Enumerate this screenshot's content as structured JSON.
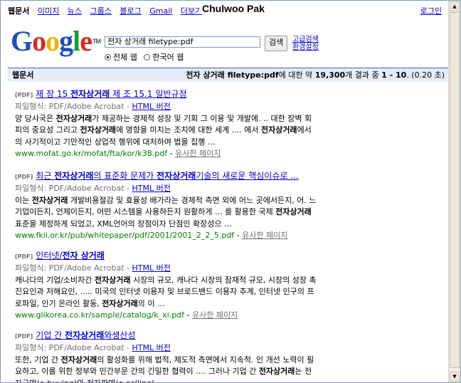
{
  "overlay_title": "Chulwoo Pak",
  "nav": {
    "items": [
      "웹문서",
      "이미지",
      "뉴스",
      "그룹스",
      "블로그",
      "Gmail",
      "더보기"
    ],
    "login": "로그인"
  },
  "logo": {
    "letters": [
      "G",
      "o",
      "o",
      "g",
      "l",
      "e"
    ],
    "colors": [
      "#1a4fc4",
      "#d62b22",
      "#f0b400",
      "#1a4fc4",
      "#189b3c",
      "#d62b22"
    ],
    "tm": "TM"
  },
  "search": {
    "query": "전자 상거래 filetype:pdf",
    "button": "검색",
    "advanced": "고급검색",
    "prefs": "환경설정"
  },
  "radios": [
    {
      "label": "전체 웹",
      "selected": true
    },
    {
      "label": "한국어 웹",
      "selected": false
    }
  ],
  "resultbar": {
    "left": "웹문서",
    "query": "전자 상거래 filetype:pdf",
    "text1": "에 대한 약 ",
    "count": "19,300",
    "text2": "개 결과 중 ",
    "range": "1 - 10",
    "time": ". (0.20 초)"
  },
  "results": [
    {
      "tag": "[PDF]",
      "title": "제 장 15 전자상거래 제 조 15.1 일반규정",
      "ftype_label": "파일형식: PDF/Adobe Acrobat - ",
      "html": "HTML 버전",
      "lines": [
        "양 당사국은 전자상거래가 제공하는 경제적 성장 및 기회 그 이용 및 개발에. .. 대한 장벽 회",
        "피의 중요성 그리고 전자상거래에 영향을 미치는 조치에 대한 세계 .... 에서 전자상거래에서",
        "의 사기적이고 기만적인 상업적 행위에 대처하여 법을 집행 ..."
      ],
      "url": "www.mofat.go.kr/mofat/fta/kor/k38.pdf",
      "sim": "유사한 페이지"
    },
    {
      "tag": "[PDF]",
      "title": "최근 전자상거래의 표준화 문제가 전자상거래기술의 새로운 핵심이슈로 ...",
      "ftype_label": "파일형식: PDF/Adobe Acrobat - ",
      "html": "HTML 버전",
      "lines": [
        "이는 전자상거래 개발비용절감 및 효율성 배가라는 경제적 측면 외에 어느 곳에서든지, 어. 느",
        "기업이든지, 언제이든지, 어떤 시스템을 사용하든지 원활하게 ... 를 활용한 국제 전자상거래",
        "표준을 제정하게 되었고, XML언어의 장점이자 단점인 확장성으 ..."
      ],
      "url": "www.fkii.or.kr/pub/whitepaper/pdf/2001/2001_2_2_5.pdf",
      "sim": "유사한 페이지"
    },
    {
      "tag": "[PDF]",
      "title": "인터넷/전자 상거래",
      "ftype_label": "파일형식: PDF/Adobe Acrobat - ",
      "html": "HTML 버전",
      "lines": [
        "캐나다의 기업/소비자간 전자상거래 시장의 규모, 캐나다 시장의 잠재적 규모, 시장의 성장 촉",
        "진요인과 저해요인, ..... 미국의 인터넷 이용자 및 브로드밴드 이용자 추계, 인터넷 인구의 프",
        "로파일, 인기 온라인 활동, 전자상거래의 이 ..."
      ],
      "url": "www.glikorea.co.kr/sample/catalog/k_xi.pdf",
      "sim": "유사한 페이지"
    },
    {
      "tag": "[PDF]",
      "title": "기업 간 전자상거래와생산성",
      "ftype_label": "파일형식: PDF/Adobe Acrobat - ",
      "html": "HTML 버전",
      "lines": [
        "또한, 기업 간 전자상거래의 활성화를 위해 법적, 제도적 측면에서 지속적. 인 개선 노력이 필",
        "요하고, 이를 위한 정부와 민간부문 간의 긴밀한 협력이 .... 그러나 기업 간 전자상거래는 전",
        "자구매(e-buying)와 전자판매(e-selling)..."
      ]
    }
  ],
  "scrollbar": {
    "up": "▲",
    "down": "▼"
  }
}
